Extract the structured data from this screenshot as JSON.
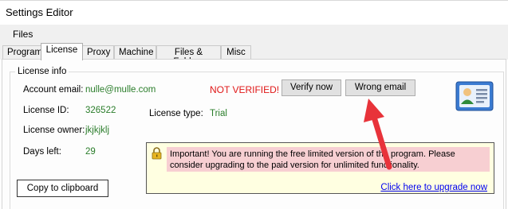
{
  "window": {
    "title": "Settings Editor"
  },
  "menu": {
    "items": [
      {
        "label": "Files"
      }
    ]
  },
  "tabs": [
    {
      "label": "Program",
      "active": false
    },
    {
      "label": "License",
      "active": true
    },
    {
      "label": "Proxy",
      "active": false
    },
    {
      "label": "Machine",
      "active": false
    },
    {
      "label": "Files & Folders",
      "active": false
    },
    {
      "label": "Misc",
      "active": false
    }
  ],
  "license": {
    "group_title": "License info",
    "account_email_label": "Account email:",
    "account_email": "nulle@mulle.com",
    "status": "NOT VERIFIED!",
    "verify_button": "Verify now",
    "wrong_email_button": "Wrong email",
    "license_id_label": "License ID:",
    "license_id": "326522",
    "license_type_label": "License type:",
    "license_type": "Trial",
    "license_owner_label": "License owner:",
    "license_owner": "jkjkjklj",
    "days_left_label": "Days left:",
    "days_left": "29",
    "copy_button": "Copy to clipboard"
  },
  "notice": {
    "icon": "lock-icon",
    "message": "Important! You are running the free limited version of the program. Please consider upgrading to the paid version for unlimited functionality.",
    "upgrade_link": "Click here to upgrade now"
  },
  "colors": {
    "value_green": "#2a7d2a",
    "warning_red": "#e01818",
    "notice_bg": "#ffffe1",
    "highlight_pink": "#f7cfd2",
    "arrow_red": "#e8333a",
    "link_blue": "#0000ee"
  }
}
